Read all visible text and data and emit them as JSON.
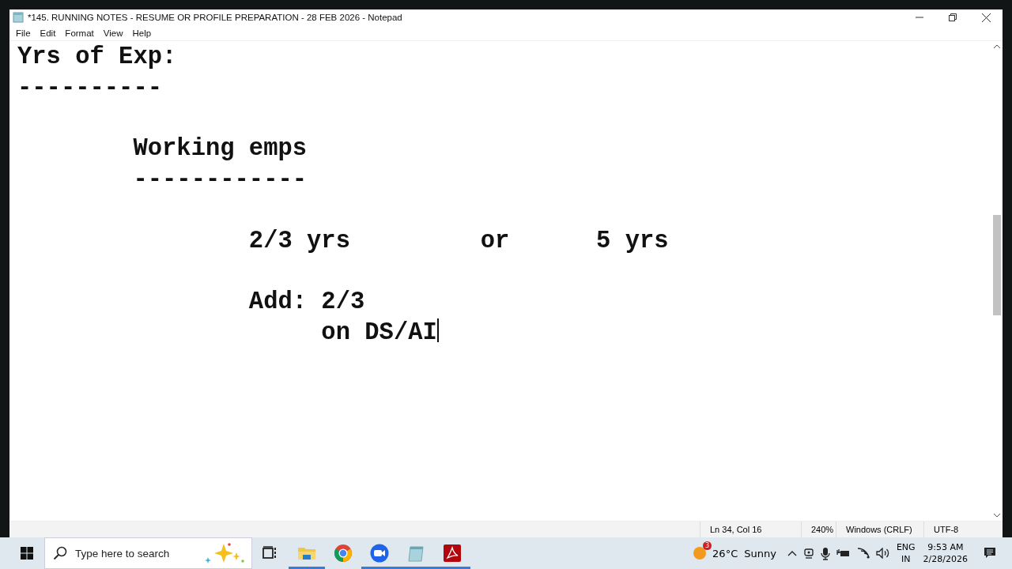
{
  "window": {
    "title": "*145. RUNNING NOTES - RESUME OR PROFILE PREPARATION - 28 FEB 2026 - Notepad"
  },
  "menu": [
    "File",
    "Edit",
    "Format",
    "View",
    "Help"
  ],
  "editor": {
    "text": "Yrs of Exp:\n----------\n\n        Working emps\n        ------------\n\n                2/3 yrs         or      5 yrs\n\n                Add: 2/3\n                     on DS/AI"
  },
  "status_bar": [
    "Ln 34, Col 16",
    "240%",
    "Windows (CRLF)",
    "UTF-8"
  ],
  "taskbar": {
    "search_placeholder": "Type here to search",
    "weather_badge": "3",
    "temperature": "26°C",
    "weather": "Sunny",
    "language": "ENG",
    "region": "IN",
    "time": "9:53 AM",
    "date": "2/28/2026",
    "apps": [
      {
        "kind": "task-view",
        "active": false
      },
      {
        "kind": "folder",
        "active": true
      },
      {
        "kind": "chrome",
        "active": false
      },
      {
        "kind": "zoom",
        "active": true
      },
      {
        "kind": "notepad",
        "active": true
      },
      {
        "kind": "pdf",
        "active": true
      }
    ]
  }
}
